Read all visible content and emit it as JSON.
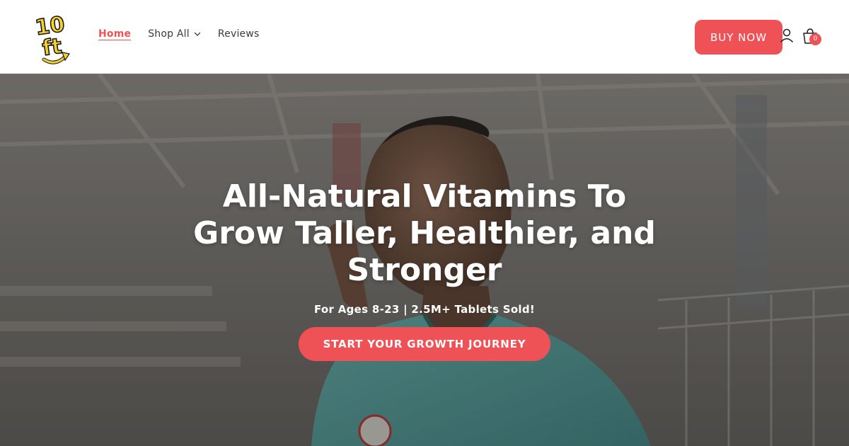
{
  "brand": {
    "logo_text": "10ft",
    "logo_colors": {
      "fill": "#f5d130",
      "outline": "#1a1a1a"
    }
  },
  "nav": {
    "items": [
      {
        "label": "Home",
        "active": true
      },
      {
        "label": "Shop All",
        "has_dropdown": true,
        "icon": "chevron-down-icon"
      },
      {
        "label": "Reviews"
      }
    ]
  },
  "header_actions": {
    "buy_label": "BUY NOW",
    "account_icon": "user-icon",
    "cart_icon": "cart-icon",
    "cart_count": "0"
  },
  "hero": {
    "title": "All-Natural Vitamins To Grow Taller, Healthier, and Stronger",
    "subtitle": "For Ages 8-23 | 2.5M+ Tablets Sold!",
    "cta_label": "START YOUR GROWTH JOURNEY"
  },
  "colors": {
    "accent": "#ef5256",
    "header_bg": "#ffffff",
    "hero_text": "#ffffff"
  }
}
